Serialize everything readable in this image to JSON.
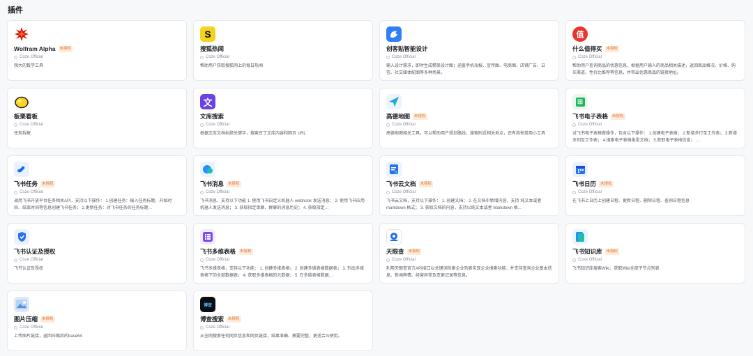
{
  "page": {
    "title": "插件"
  },
  "badge_text": "未授权",
  "plugins": [
    {
      "name": "Wolfram Alpha",
      "badge": true,
      "author": "Coze Official",
      "desc": "强大的数学工具",
      "icon": "wolfram-star-icon"
    },
    {
      "name": "搜狐热闻",
      "badge": false,
      "author": "Coze Official",
      "desc": "帮助用户获取搜狐网上的每日热闻",
      "icon": "sohu-logo-icon"
    },
    {
      "name": "创客贴智能设计",
      "badge": false,
      "author": "Coze Official",
      "desc": "输入设计需求，即时生成精美设计图；涵盖手机海报、宣传图、电商图、店铺广告、日签、社交媒体配图等多种场景。",
      "icon": "chuangkit-logo-icon"
    },
    {
      "name": "什么值得买",
      "badge": true,
      "author": "Coze Official",
      "desc": "帮助用户查询商品的优惠信息，根据用户输入的商品相关描述，返回商品概况、价格、购买渠道、性价比推荐等信息，并带出优惠商品的链接地址。",
      "icon": "smzdm-logo-icon"
    },
    {
      "name": "板栗看板",
      "badge": false,
      "author": "Coze Official",
      "desc": "任务拆解",
      "icon": "banli-logo-icon"
    },
    {
      "name": "文库搜索",
      "badge": false,
      "author": "Coze Official",
      "desc": "根据文库文档标题关键字，搜索豆丁文库内容和网页 URL",
      "icon": "wenku-logo-icon"
    },
    {
      "name": "高德地图",
      "badge": true,
      "author": "Coze Official",
      "desc": "高德地图相关工具，可以帮助用户规划路线，搜索附近相关地点，还有其他常用小工具",
      "icon": "amap-logo-icon"
    },
    {
      "name": "飞书电子表格",
      "badge": true,
      "author": "Coze Official",
      "desc": "对飞书电子表格做操作，包含以下操作： 1.创建电子表格； 2.新增多行至工作表； 3.新增多列至工作表； 4.搜索电子表格类型文档； 5.获取电子表格信息； …",
      "icon": "feishu-sheet-icon"
    },
    {
      "name": "飞书任务",
      "badge": true,
      "author": "Coze Official",
      "desc": "调用飞书开放平台任务相关API，支持以下操作： 1.创建任务：输入任务标题、开始时间、结束时间等信息创建飞书任务； 2.更新任务：对飞书任务的任务标题…",
      "icon": "feishu-task-icon"
    },
    {
      "name": "飞书消息",
      "badge": true,
      "author": "Coze Official",
      "desc": "飞书消息，支持以下功能 1. 使用飞书自定义机器人 webhook 发送消息； 2. 使用飞书应用机器人发送消息； 3. 获取指定单聊、群聊的消息历史； 4. 获取指定…",
      "icon": "feishu-message-icon"
    },
    {
      "name": "飞书云文档",
      "badge": true,
      "author": "Coze Official",
      "desc": "飞书云文档，支持以下操作： 1. 创建文档； 2. 在文档中新增内容，支持 纯文本或者 markdown 格式； 3. 获取文档的内容，支持以纯文本或者 Markdown 格...",
      "icon": "feishu-doc-icon"
    },
    {
      "name": "飞书日历",
      "badge": true,
      "author": "Coze Official",
      "desc": "在飞书上日历上创建日程、更新日程、删除日程、查询日程信息",
      "icon": "feishu-calendar-icon"
    },
    {
      "name": "飞书认证及授权",
      "badge": false,
      "author": "Coze Official",
      "desc": "飞书认证及授权",
      "icon": "feishu-auth-icon"
    },
    {
      "name": "飞书多维表格",
      "badge": true,
      "author": "Coze Official",
      "desc": "飞书多维表格，支持以下功能： 1. 创建多维表格； 2. 创建多维表格数据表； 3. 列出多维表格下的全部数据表； 4. 获取多维表格的元数据； 5. 在多维表格数据…",
      "icon": "feishu-bitable-icon"
    },
    {
      "name": "天眼查",
      "badge": true,
      "author": "Coze Official",
      "desc": "利用天眼查官方API接口以关键词检索企业列表实现企业搜索功能，并支持查询企业基本信息、新闻舆情、经营异常及变更记录等信息。",
      "icon": "tianyancha-logo-icon"
    },
    {
      "name": "飞书知识库",
      "badge": true,
      "author": "Coze Official",
      "desc": "飞书知识库搜索Wiki、获取Wiki全部子节点列表",
      "icon": "feishu-wiki-icon"
    },
    {
      "name": "图片压缩",
      "badge": true,
      "author": "Coze Official",
      "desc": "上传图片链接，返回压缩后的base64",
      "icon": "image-compress-icon"
    },
    {
      "name": "博查搜索",
      "badge": true,
      "author": "Coze Official",
      "desc": "从全网搜索任何网页信息和网页链接，结果准确、摘要完整，更适合AI使用。",
      "icon": "bocha-logo-icon"
    }
  ],
  "icon_glyphs": {
    "sohu": "S",
    "wenku": "文",
    "feishu_sheet": "⊞",
    "bocha": "博查",
    "smzdm": "值"
  },
  "colors": {
    "badge_text": "#e5762c",
    "badge_bg": "#fdebdc"
  }
}
